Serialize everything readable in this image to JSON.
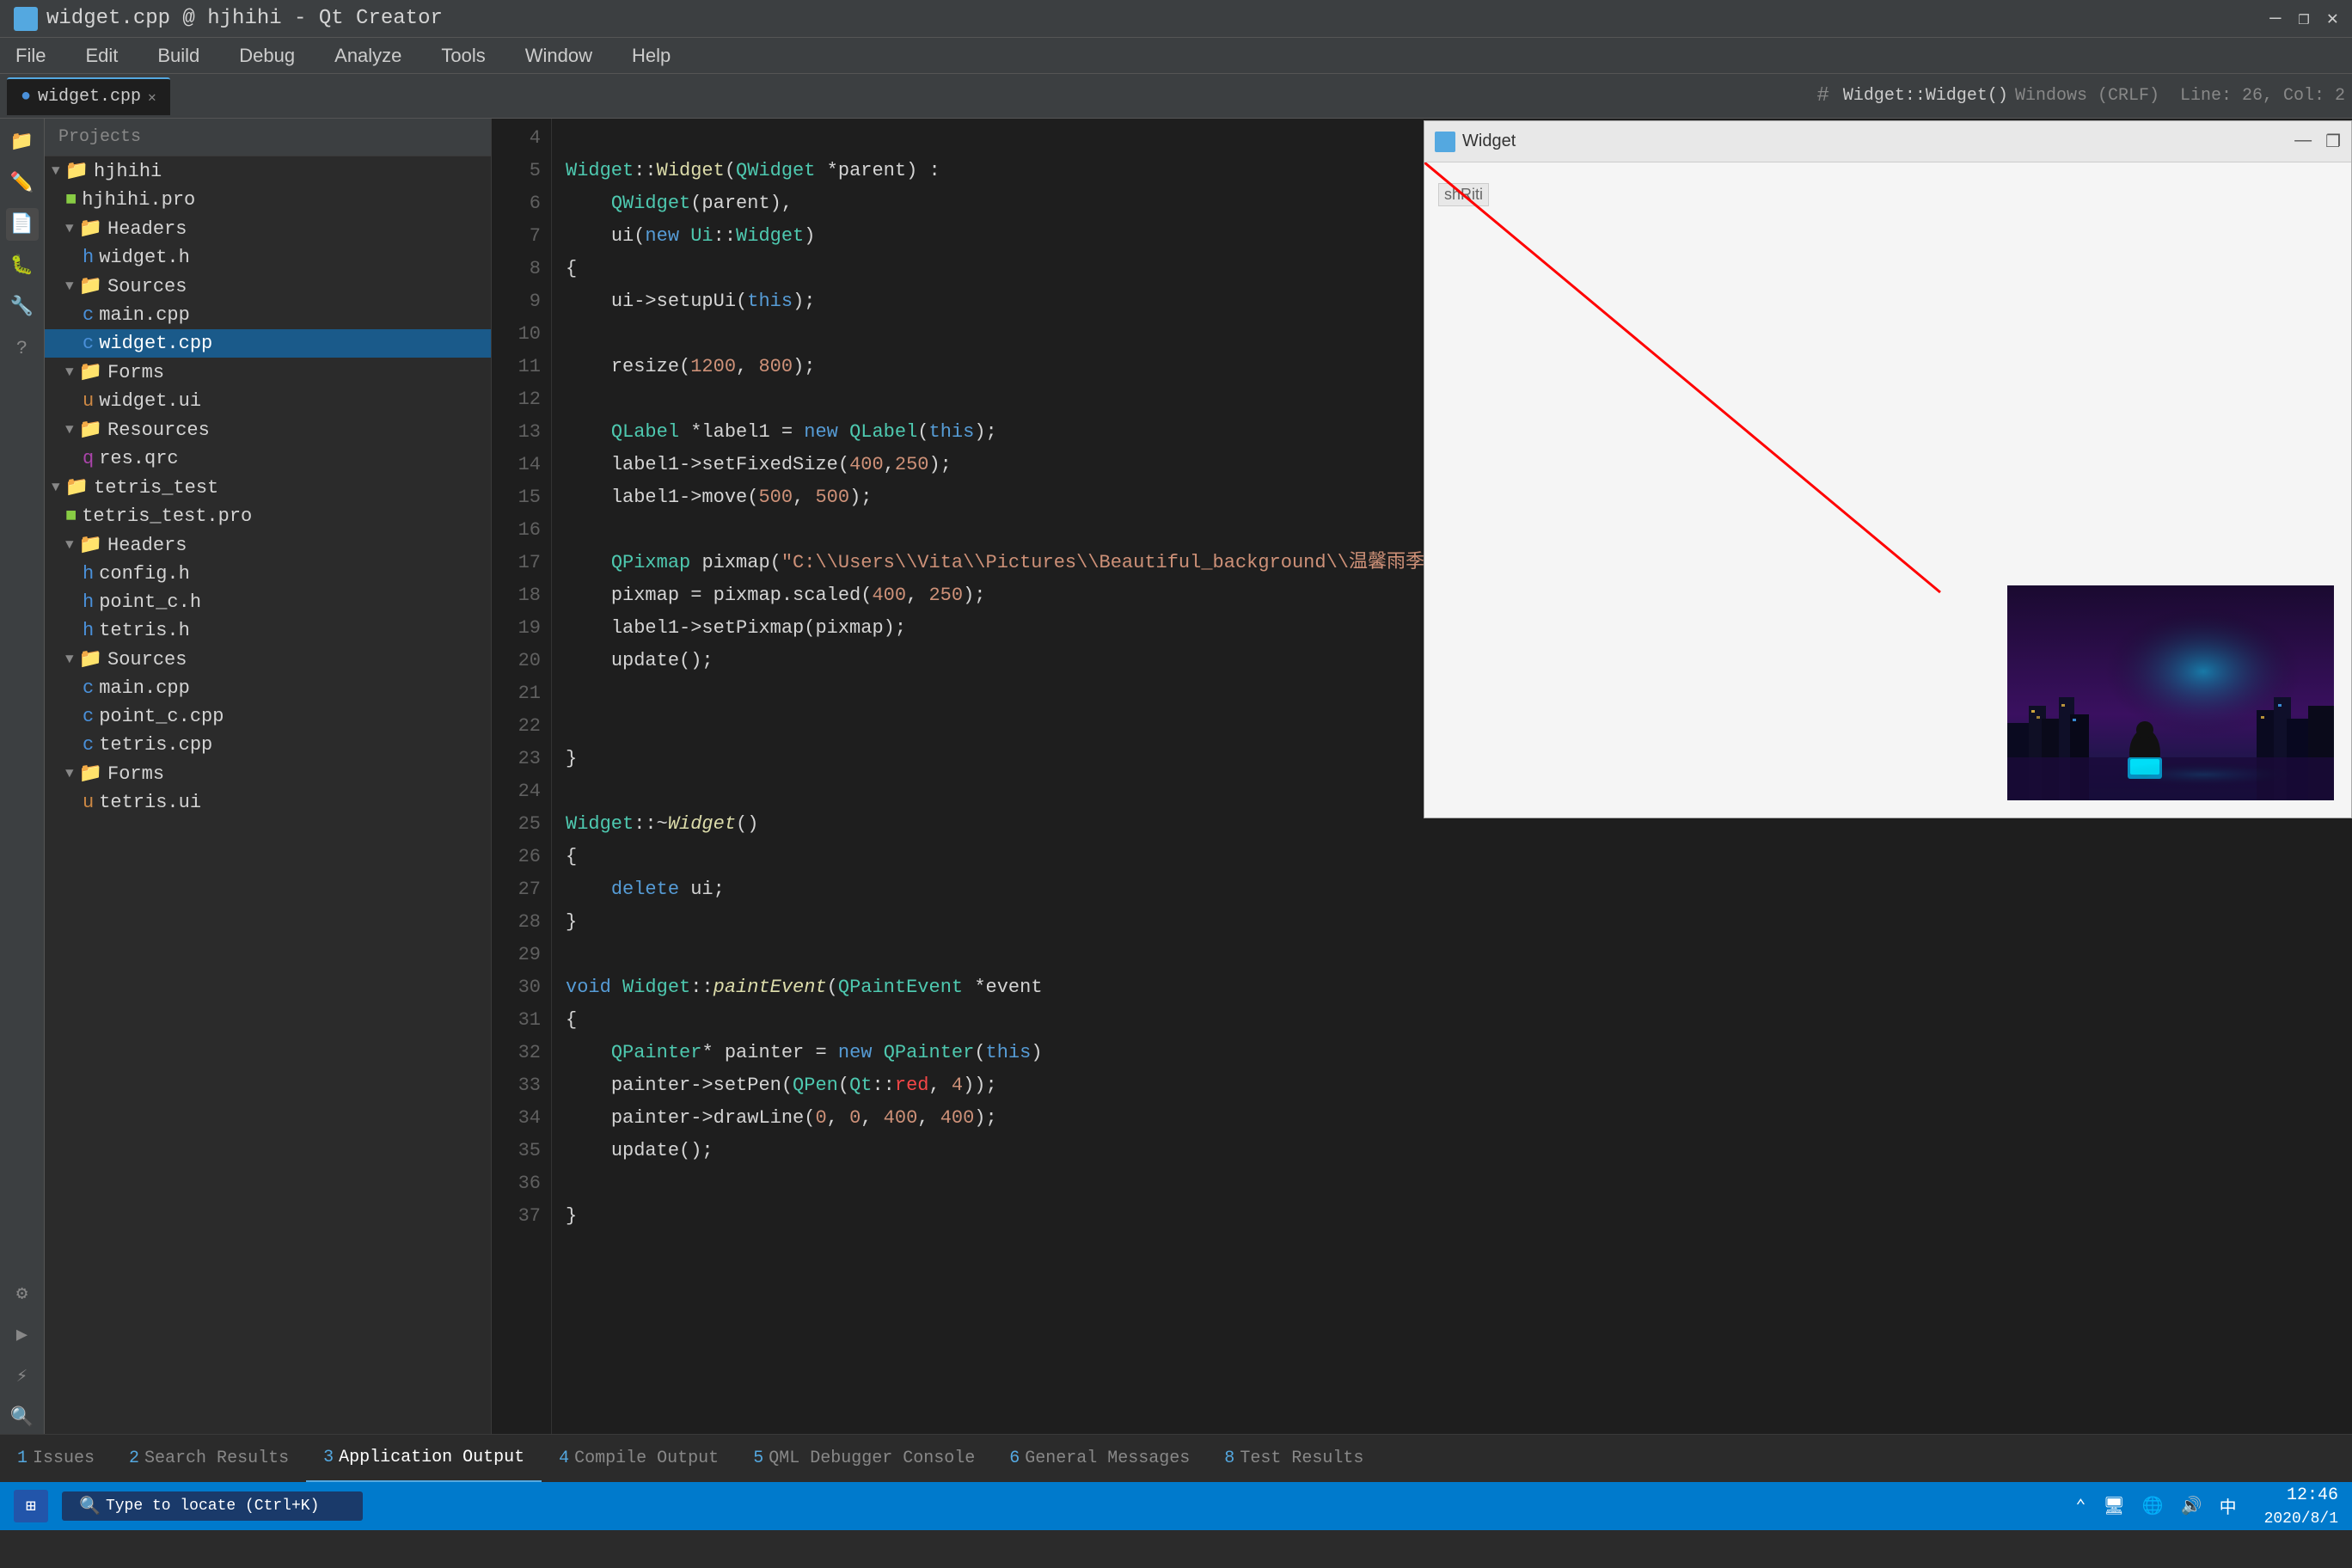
{
  "titlebar": {
    "title": "widget.cpp @ hjhihi - Qt Creator",
    "minimize": "—",
    "maximize": "❐",
    "close": "✕"
  },
  "menubar": {
    "items": [
      "File",
      "Edit",
      "Build",
      "Debug",
      "Analyze",
      "Tools",
      "Window",
      "Help"
    ]
  },
  "toolbar": {
    "breadcrumb": "Widget::Widget()",
    "filename": "widget.cpp",
    "line_info": "Line: 26, Col: 2",
    "encoding": "Windows (CRLF)"
  },
  "project_panel": {
    "title": "Projects",
    "tree": [
      {
        "label": "hjhihi",
        "indent": 0,
        "type": "project",
        "expanded": true
      },
      {
        "label": "hjhihi.pro",
        "indent": 1,
        "type": "pro"
      },
      {
        "label": "Headers",
        "indent": 1,
        "type": "folder",
        "expanded": true
      },
      {
        "label": "widget.h",
        "indent": 2,
        "type": "h"
      },
      {
        "label": "Sources",
        "indent": 1,
        "type": "folder",
        "expanded": true
      },
      {
        "label": "main.cpp",
        "indent": 2,
        "type": "cpp"
      },
      {
        "label": "widget.cpp",
        "indent": 2,
        "type": "cpp",
        "selected": true
      },
      {
        "label": "Forms",
        "indent": 1,
        "type": "folder",
        "expanded": true
      },
      {
        "label": "widget.ui",
        "indent": 2,
        "type": "ui"
      },
      {
        "label": "Resources",
        "indent": 1,
        "type": "folder",
        "expanded": true
      },
      {
        "label": "res.qrc",
        "indent": 2,
        "type": "qrc"
      },
      {
        "label": "tetris_test",
        "indent": 0,
        "type": "project",
        "expanded": true
      },
      {
        "label": "tetris_test.pro",
        "indent": 1,
        "type": "pro"
      },
      {
        "label": "Headers",
        "indent": 1,
        "type": "folder",
        "expanded": true
      },
      {
        "label": "config.h",
        "indent": 2,
        "type": "h"
      },
      {
        "label": "point_c.h",
        "indent": 2,
        "type": "h"
      },
      {
        "label": "tetris.h",
        "indent": 2,
        "type": "h"
      },
      {
        "label": "Sources",
        "indent": 1,
        "type": "folder",
        "expanded": true
      },
      {
        "label": "main.cpp",
        "indent": 2,
        "type": "cpp"
      },
      {
        "label": "point_c.cpp",
        "indent": 2,
        "type": "cpp"
      },
      {
        "label": "tetris.cpp",
        "indent": 2,
        "type": "cpp"
      },
      {
        "label": "Forms",
        "indent": 1,
        "type": "folder",
        "expanded": true
      },
      {
        "label": "tetris.ui",
        "indent": 2,
        "type": "ui"
      }
    ]
  },
  "editor": {
    "filename": "widget.cpp",
    "tab_label": "widget.cpp",
    "lines": [
      {
        "num": 4,
        "content": ""
      },
      {
        "num": 5,
        "content": "Widget::Widget(QWidget *parent) :"
      },
      {
        "num": 6,
        "content": "    QWidget(parent),"
      },
      {
        "num": 7,
        "content": "    ui(new Ui::Widget)"
      },
      {
        "num": 8,
        "content": "{"
      },
      {
        "num": 9,
        "content": "    ui->setupUi(this);"
      },
      {
        "num": 10,
        "content": ""
      },
      {
        "num": 11,
        "content": "    resize(1200, 800);"
      },
      {
        "num": 12,
        "content": ""
      },
      {
        "num": 13,
        "content": "    QLabel *label1 = new QLabel(this);"
      },
      {
        "num": 14,
        "content": "    label1->setFixedSize(400,250);"
      },
      {
        "num": 15,
        "content": "    label1->move(500, 500);"
      },
      {
        "num": 16,
        "content": ""
      },
      {
        "num": 17,
        "content": "    QPixmap pixmap(\"C:\\\\Users\\\\Vita\\\\Pictures\\\\Beautiful_background\\\\温馨雨季.jpg\");"
      },
      {
        "num": 18,
        "content": "    pixmap = pixmap.scaled(400, 250);"
      },
      {
        "num": 19,
        "content": "    label1->setPixmap(pixmap);"
      },
      {
        "num": 20,
        "content": "    update();"
      },
      {
        "num": 21,
        "content": ""
      },
      {
        "num": 22,
        "content": ""
      },
      {
        "num": 23,
        "content": "}"
      },
      {
        "num": 24,
        "content": ""
      },
      {
        "num": 25,
        "content": "Widget::~Widget()"
      },
      {
        "num": 26,
        "content": "{"
      },
      {
        "num": 27,
        "content": "    delete ui;"
      },
      {
        "num": 28,
        "content": "}"
      },
      {
        "num": 29,
        "content": ""
      },
      {
        "num": 30,
        "content": "void Widget::paintEvent(QPaintEvent *event"
      },
      {
        "num": 31,
        "content": "{"
      },
      {
        "num": 32,
        "content": "    QPainter* painter = new QPainter(this)"
      },
      {
        "num": 33,
        "content": "    painter->setPen(QPen(Qt::red, 4));"
      },
      {
        "num": 34,
        "content": "    painter->drawLine(0, 0, 400, 400);"
      },
      {
        "num": 35,
        "content": "    update();"
      },
      {
        "num": 36,
        "content": ""
      },
      {
        "num": 37,
        "content": "}"
      }
    ]
  },
  "widget_window": {
    "title": "Widget",
    "label_text": "shRiti",
    "minimize": "—",
    "maximize": "❐"
  },
  "bottom_tabs": [
    {
      "num": "1",
      "label": "Issues"
    },
    {
      "num": "2",
      "label": "Search Results"
    },
    {
      "num": "3",
      "label": "Application Output",
      "active": true
    },
    {
      "num": "4",
      "label": "Compile Output"
    },
    {
      "num": "5",
      "label": "QML Debugger Console"
    },
    {
      "num": "6",
      "label": "General Messages"
    },
    {
      "num": "8",
      "label": "Test Results"
    }
  ],
  "statusbar": {
    "windows_icon": "⊞",
    "search_placeholder": "Type to locate (Ctrl+K)",
    "line_col": "Line: 26, Col: 2",
    "encoding": "Windows (CRLF)",
    "time": "12:46",
    "date": "2020/8/1"
  }
}
